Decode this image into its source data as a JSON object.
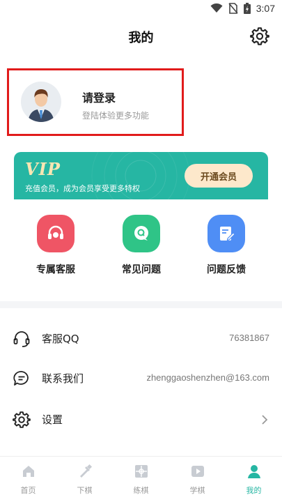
{
  "status_bar": {
    "time": "3:07"
  },
  "header": {
    "title": "我的"
  },
  "login": {
    "title": "请登录",
    "subtitle": "登陆体验更多功能"
  },
  "vip": {
    "logo": "VIP",
    "description": "充值会员，成为会员享受更多特权",
    "button_label": "开通会员"
  },
  "quick_actions": [
    {
      "label": "专属客服",
      "icon": "headset-icon",
      "color": "#ef5565"
    },
    {
      "label": "常见问题",
      "icon": "question-bubble-icon",
      "color": "#2fc487"
    },
    {
      "label": "问题反馈",
      "icon": "feedback-edit-icon",
      "color": "#4f8ef5"
    }
  ],
  "menu": [
    {
      "label": "客服QQ",
      "value": "76381867",
      "icon": "headset-outline-icon"
    },
    {
      "label": "联系我们",
      "value": "zhenggaoshenzhen@163.com",
      "icon": "chat-bubble-icon"
    },
    {
      "label": "设置",
      "value": "",
      "icon": "gear-icon"
    }
  ],
  "bottom_nav": [
    {
      "label": "首页",
      "icon": "home-icon"
    },
    {
      "label": "下棋",
      "icon": "sword-icon"
    },
    {
      "label": "练棋",
      "icon": "board-icon"
    },
    {
      "label": "学棋",
      "icon": "play-icon"
    },
    {
      "label": "我的",
      "icon": "user-icon",
      "active": true
    }
  ],
  "colors": {
    "accent": "#26b6a3",
    "highlight_border": "#e11b1b",
    "vip_button": "#fde8cb"
  }
}
